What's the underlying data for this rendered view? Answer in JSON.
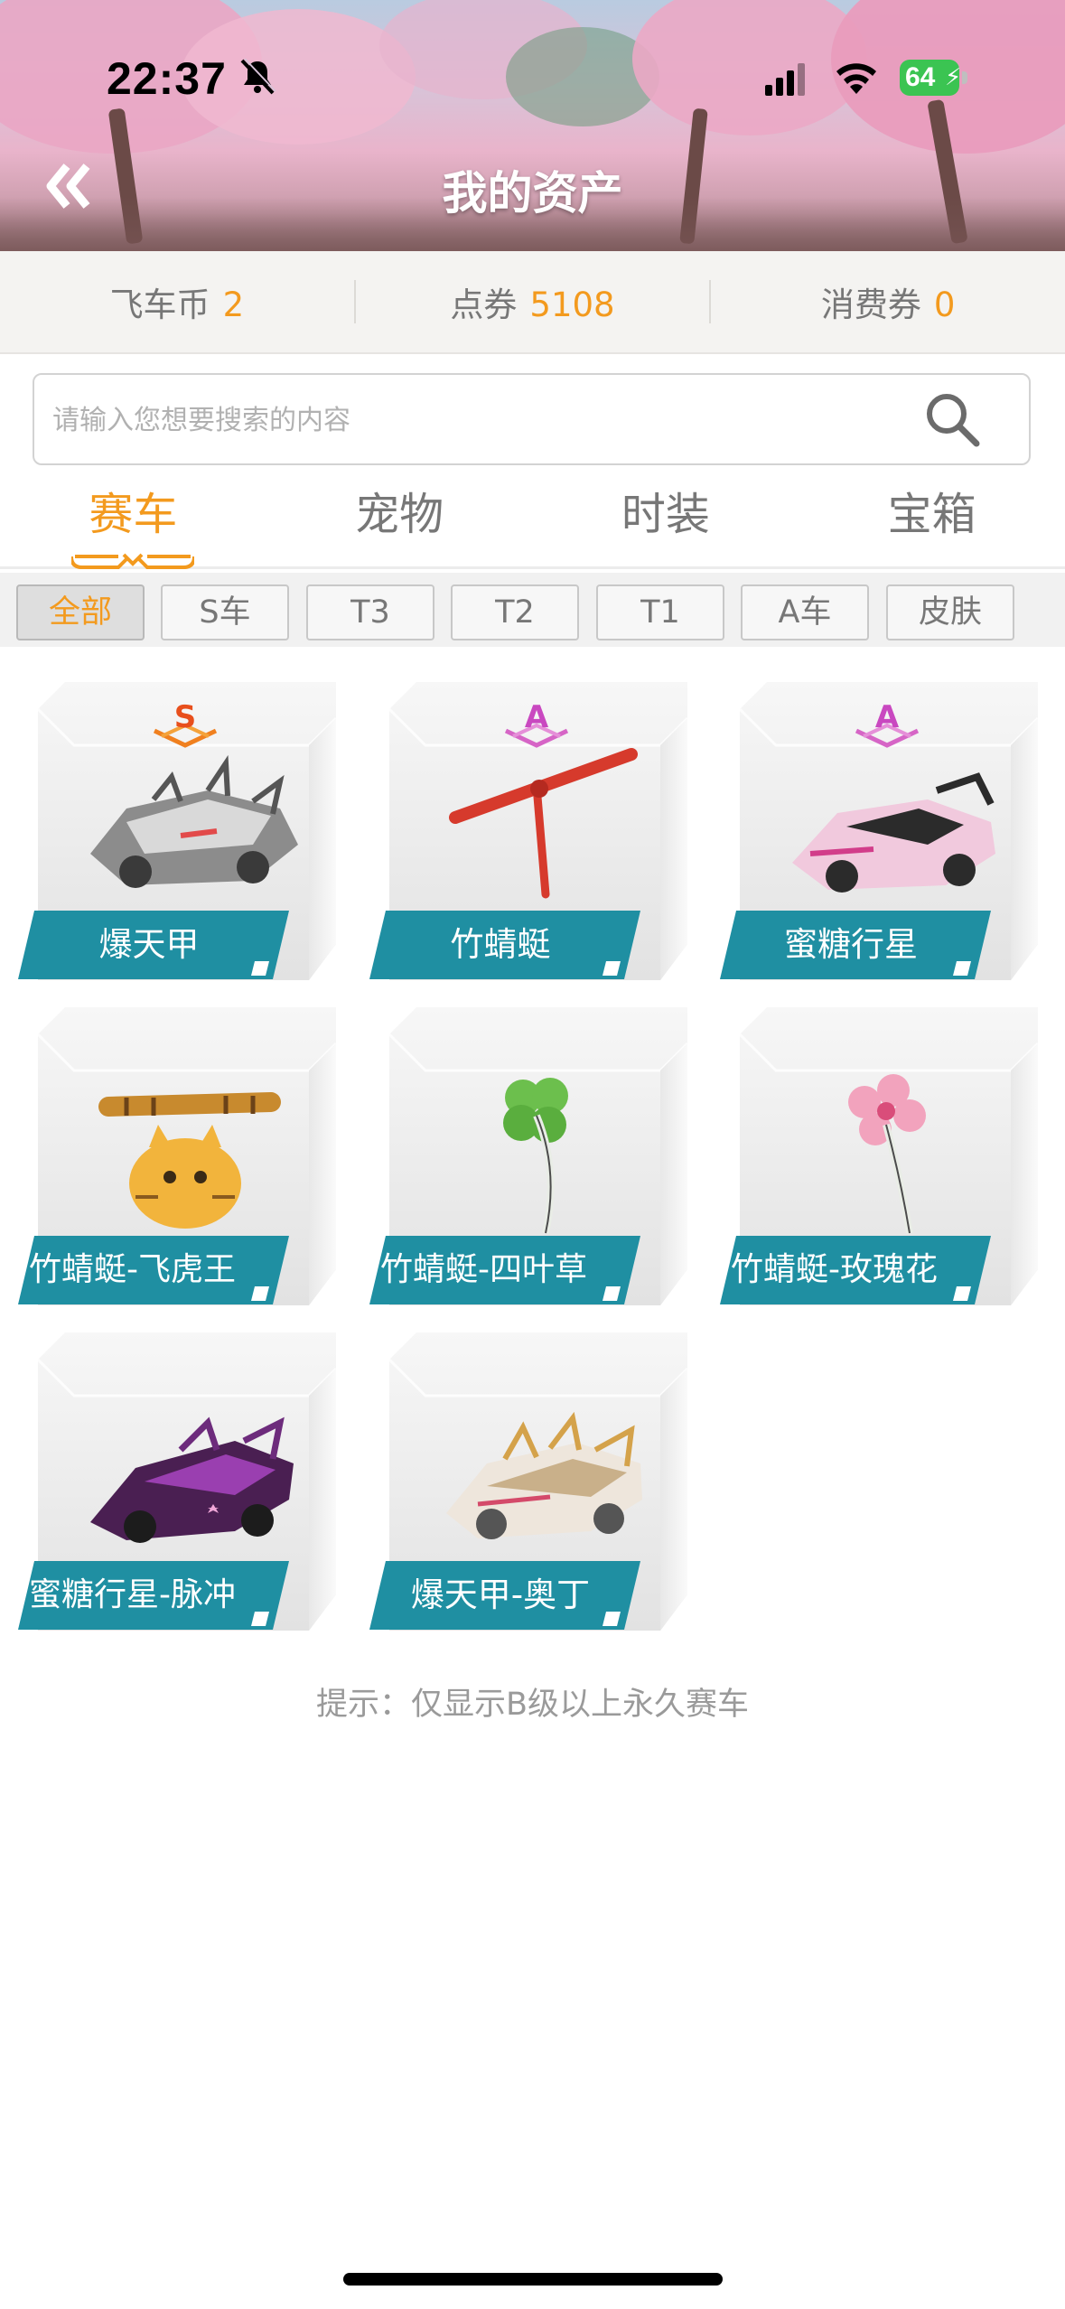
{
  "status_bar": {
    "time": "22:37",
    "battery": "64"
  },
  "header": {
    "title": "我的资产"
  },
  "balances": [
    {
      "label": "飞车币",
      "value": "2"
    },
    {
      "label": "点券",
      "value": "5108"
    },
    {
      "label": "消费券",
      "value": "0"
    }
  ],
  "search": {
    "placeholder": "请输入您想要搜索的内容"
  },
  "tabs": [
    {
      "label": "赛车",
      "active": true
    },
    {
      "label": "宠物",
      "active": false
    },
    {
      "label": "时装",
      "active": false
    },
    {
      "label": "宝箱",
      "active": false
    }
  ],
  "filters": [
    {
      "label": "全部",
      "active": true
    },
    {
      "label": "S车",
      "active": false
    },
    {
      "label": "T3",
      "active": false
    },
    {
      "label": "T2",
      "active": false
    },
    {
      "label": "T1",
      "active": false
    },
    {
      "label": "A车",
      "active": false
    },
    {
      "label": "皮肤",
      "active": false
    }
  ],
  "items": [
    {
      "name": "爆天甲",
      "grade": "S"
    },
    {
      "name": "竹蜻蜓",
      "grade": "A"
    },
    {
      "name": "蜜糖行星",
      "grade": "A"
    },
    {
      "name": "竹蜻蜓-飞虎王",
      "grade": ""
    },
    {
      "name": "竹蜻蜓-四叶草",
      "grade": ""
    },
    {
      "name": "竹蜻蜓-玫瑰花",
      "grade": ""
    },
    {
      "name": "蜜糖行星-脉冲",
      "grade": ""
    },
    {
      "name": "爆天甲-奥丁",
      "grade": ""
    }
  ],
  "hint": "提示：仅显示B级以上永久赛车",
  "colors": {
    "accent": "#f39a1e",
    "banner": "#1f8fa2",
    "battery": "#3bc452"
  }
}
